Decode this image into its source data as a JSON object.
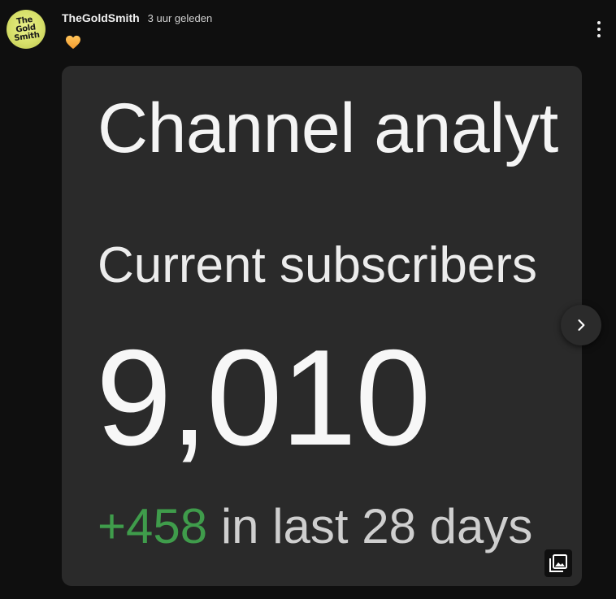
{
  "post": {
    "author": {
      "name": "TheGoldSmith",
      "avatar_text": "The\nGold\nSmith"
    },
    "timestamp": "3 uur geleden",
    "emoji_icon": "orange-heart-icon",
    "colors": {
      "background": "#0f0f0f",
      "image_background": "#2a2a2a",
      "positive_change": "#3f9c4b"
    },
    "image": {
      "title": "Channel analyt",
      "label": "Current subscribers",
      "count": "9,010",
      "change": "+458",
      "period": " in last 28 days"
    },
    "icons": {
      "menu": "more-vertical-icon",
      "next": "chevron-right-icon",
      "gallery": "gallery-icon"
    }
  }
}
